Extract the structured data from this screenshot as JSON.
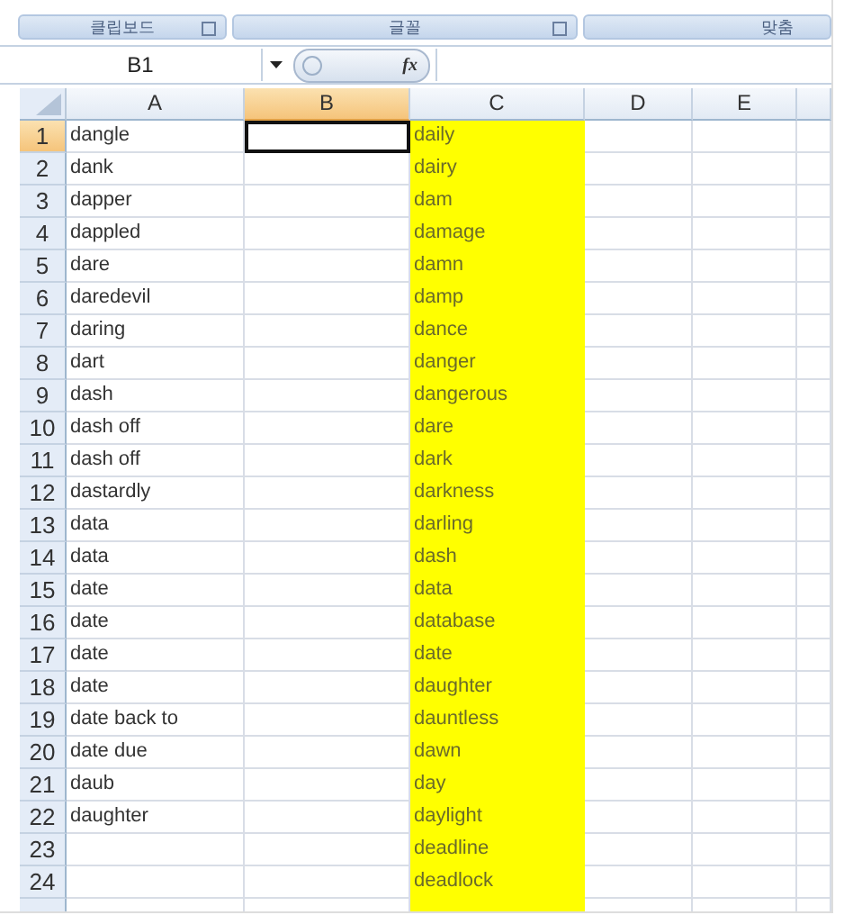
{
  "ribbon_groups": [
    {
      "label": "클립보드",
      "launcher": true
    },
    {
      "label": "글꼴",
      "launcher": true
    },
    {
      "label": "맞춤",
      "launcher": false
    }
  ],
  "name_box": "B1",
  "formula_button": "fx",
  "columns": [
    {
      "label": "A",
      "selected": false,
      "highlighted": false
    },
    {
      "label": "B",
      "selected": true,
      "highlighted": false
    },
    {
      "label": "C",
      "selected": false,
      "highlighted": true
    },
    {
      "label": "D",
      "selected": false,
      "highlighted": false
    },
    {
      "label": "E",
      "selected": false,
      "highlighted": false
    }
  ],
  "rows": [
    {
      "number": "1",
      "selected": true,
      "a": "dangle",
      "c": "daily"
    },
    {
      "number": "2",
      "selected": false,
      "a": "dank",
      "c": "dairy"
    },
    {
      "number": "3",
      "selected": false,
      "a": "dapper",
      "c": "dam"
    },
    {
      "number": "4",
      "selected": false,
      "a": "dappled",
      "c": "damage"
    },
    {
      "number": "5",
      "selected": false,
      "a": "dare",
      "c": "damn"
    },
    {
      "number": "6",
      "selected": false,
      "a": "daredevil",
      "c": "damp"
    },
    {
      "number": "7",
      "selected": false,
      "a": "daring",
      "c": "dance"
    },
    {
      "number": "8",
      "selected": false,
      "a": "dart",
      "c": "danger"
    },
    {
      "number": "9",
      "selected": false,
      "a": "dash",
      "c": "dangerous"
    },
    {
      "number": "10",
      "selected": false,
      "a": "dash off",
      "c": "dare"
    },
    {
      "number": "11",
      "selected": false,
      "a": "dash off",
      "c": "dark"
    },
    {
      "number": "12",
      "selected": false,
      "a": "dastardly",
      "c": "darkness"
    },
    {
      "number": "13",
      "selected": false,
      "a": "data",
      "c": "darling"
    },
    {
      "number": "14",
      "selected": false,
      "a": "data",
      "c": "dash"
    },
    {
      "number": "15",
      "selected": false,
      "a": "date",
      "c": "data"
    },
    {
      "number": "16",
      "selected": false,
      "a": "date",
      "c": "database"
    },
    {
      "number": "17",
      "selected": false,
      "a": "date",
      "c": "date"
    },
    {
      "number": "18",
      "selected": false,
      "a": "date",
      "c": "daughter"
    },
    {
      "number": "19",
      "selected": false,
      "a": "date back to",
      "c": "dauntless"
    },
    {
      "number": "20",
      "selected": false,
      "a": "date due",
      "c": "dawn"
    },
    {
      "number": "21",
      "selected": false,
      "a": "daub",
      "c": "day"
    },
    {
      "number": "22",
      "selected": false,
      "a": "daughter",
      "c": "daylight"
    },
    {
      "number": "23",
      "selected": false,
      "c": "deadline"
    },
    {
      "number": "24",
      "selected": false,
      "c": "deadlock"
    }
  ]
}
